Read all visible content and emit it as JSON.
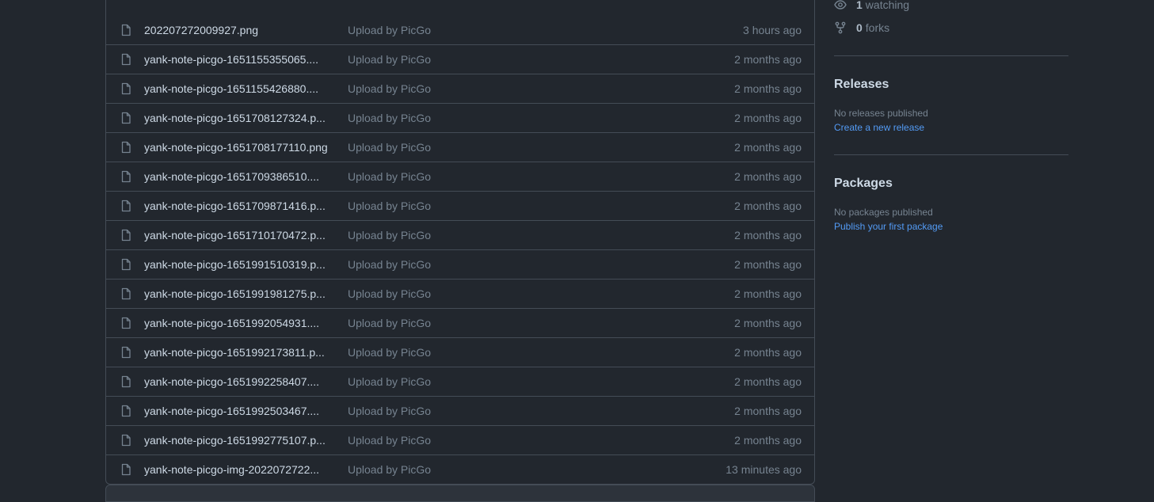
{
  "files": [
    {
      "name": "202207272009927.png",
      "message": "Upload by PicGo",
      "age": "3 hours ago"
    },
    {
      "name": "yank-note-picgo-1651155355065....",
      "message": "Upload by PicGo",
      "age": "2 months ago"
    },
    {
      "name": "yank-note-picgo-1651155426880....",
      "message": "Upload by PicGo",
      "age": "2 months ago"
    },
    {
      "name": "yank-note-picgo-1651708127324.p...",
      "message": "Upload by PicGo",
      "age": "2 months ago"
    },
    {
      "name": "yank-note-picgo-1651708177110.png",
      "message": "Upload by PicGo",
      "age": "2 months ago"
    },
    {
      "name": "yank-note-picgo-1651709386510....",
      "message": "Upload by PicGo",
      "age": "2 months ago"
    },
    {
      "name": "yank-note-picgo-1651709871416.p...",
      "message": "Upload by PicGo",
      "age": "2 months ago"
    },
    {
      "name": "yank-note-picgo-1651710170472.p...",
      "message": "Upload by PicGo",
      "age": "2 months ago"
    },
    {
      "name": "yank-note-picgo-1651991510319.p...",
      "message": "Upload by PicGo",
      "age": "2 months ago"
    },
    {
      "name": "yank-note-picgo-1651991981275.p...",
      "message": "Upload by PicGo",
      "age": "2 months ago"
    },
    {
      "name": "yank-note-picgo-1651992054931....",
      "message": "Upload by PicGo",
      "age": "2 months ago"
    },
    {
      "name": "yank-note-picgo-1651992173811.p...",
      "message": "Upload by PicGo",
      "age": "2 months ago"
    },
    {
      "name": "yank-note-picgo-1651992258407....",
      "message": "Upload by PicGo",
      "age": "2 months ago"
    },
    {
      "name": "yank-note-picgo-1651992503467....",
      "message": "Upload by PicGo",
      "age": "2 months ago"
    },
    {
      "name": "yank-note-picgo-1651992775107.p...",
      "message": "Upload by PicGo",
      "age": "2 months ago"
    },
    {
      "name": "yank-note-picgo-img-2022072722...",
      "message": "Upload by PicGo",
      "age": "13 minutes ago"
    }
  ],
  "sidebar": {
    "watching_count": "1",
    "watching_label": "watching",
    "forks_count": "0",
    "forks_label": "forks",
    "releases_title": "Releases",
    "releases_note": "No releases published",
    "releases_link": "Create a new release",
    "packages_title": "Packages",
    "packages_note": "No packages published",
    "packages_link": "Publish your first package"
  }
}
